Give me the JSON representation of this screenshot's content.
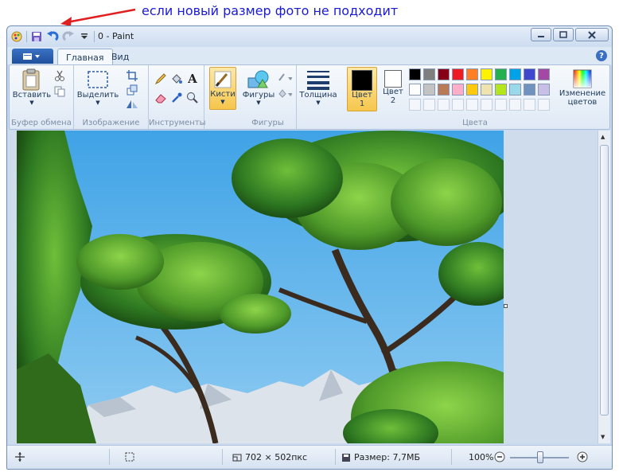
{
  "annotation": {
    "text": "если новый размер фото не подходит"
  },
  "window": {
    "title": "0 - Paint"
  },
  "tabs": [
    {
      "label": "Главная",
      "active": true
    },
    {
      "label": "Вид",
      "active": false
    }
  ],
  "ribbon": {
    "clipboard": {
      "paste_label": "Вставить",
      "group_label": "Буфер обмена"
    },
    "image": {
      "select_label": "Выделить",
      "group_label": "Изображение"
    },
    "tools": {
      "group_label": "Инструменты"
    },
    "brushes": {
      "label": "Кисти"
    },
    "shapes": {
      "label": "Фигуры",
      "group_label": "Фигуры"
    },
    "size": {
      "label": "Толщина"
    },
    "color1": {
      "label_line1": "Цвет",
      "label_line2": "1",
      "value": "#000000"
    },
    "color2": {
      "label_line1": "Цвет",
      "label_line2": "2",
      "value": "#ffffff"
    },
    "colors": {
      "group_label": "Цвета",
      "edit_label_line1": "Изменение",
      "edit_label_line2": "цветов",
      "row1": [
        "#000000",
        "#7f7f7f",
        "#880015",
        "#ed1c24",
        "#ff7f27",
        "#fff200",
        "#22b14c",
        "#00a2e8",
        "#3f48cc",
        "#a349a4"
      ],
      "row2": [
        "#ffffff",
        "#c3c3c3",
        "#b97a57",
        "#ffaec9",
        "#ffc90e",
        "#efe4b0",
        "#b5e61d",
        "#99d9ea",
        "#7092be",
        "#c8bfe7"
      ]
    }
  },
  "status": {
    "dimensions": "702 × 502пкс",
    "size": "Размер: 7,7МБ",
    "zoom": "100%"
  }
}
